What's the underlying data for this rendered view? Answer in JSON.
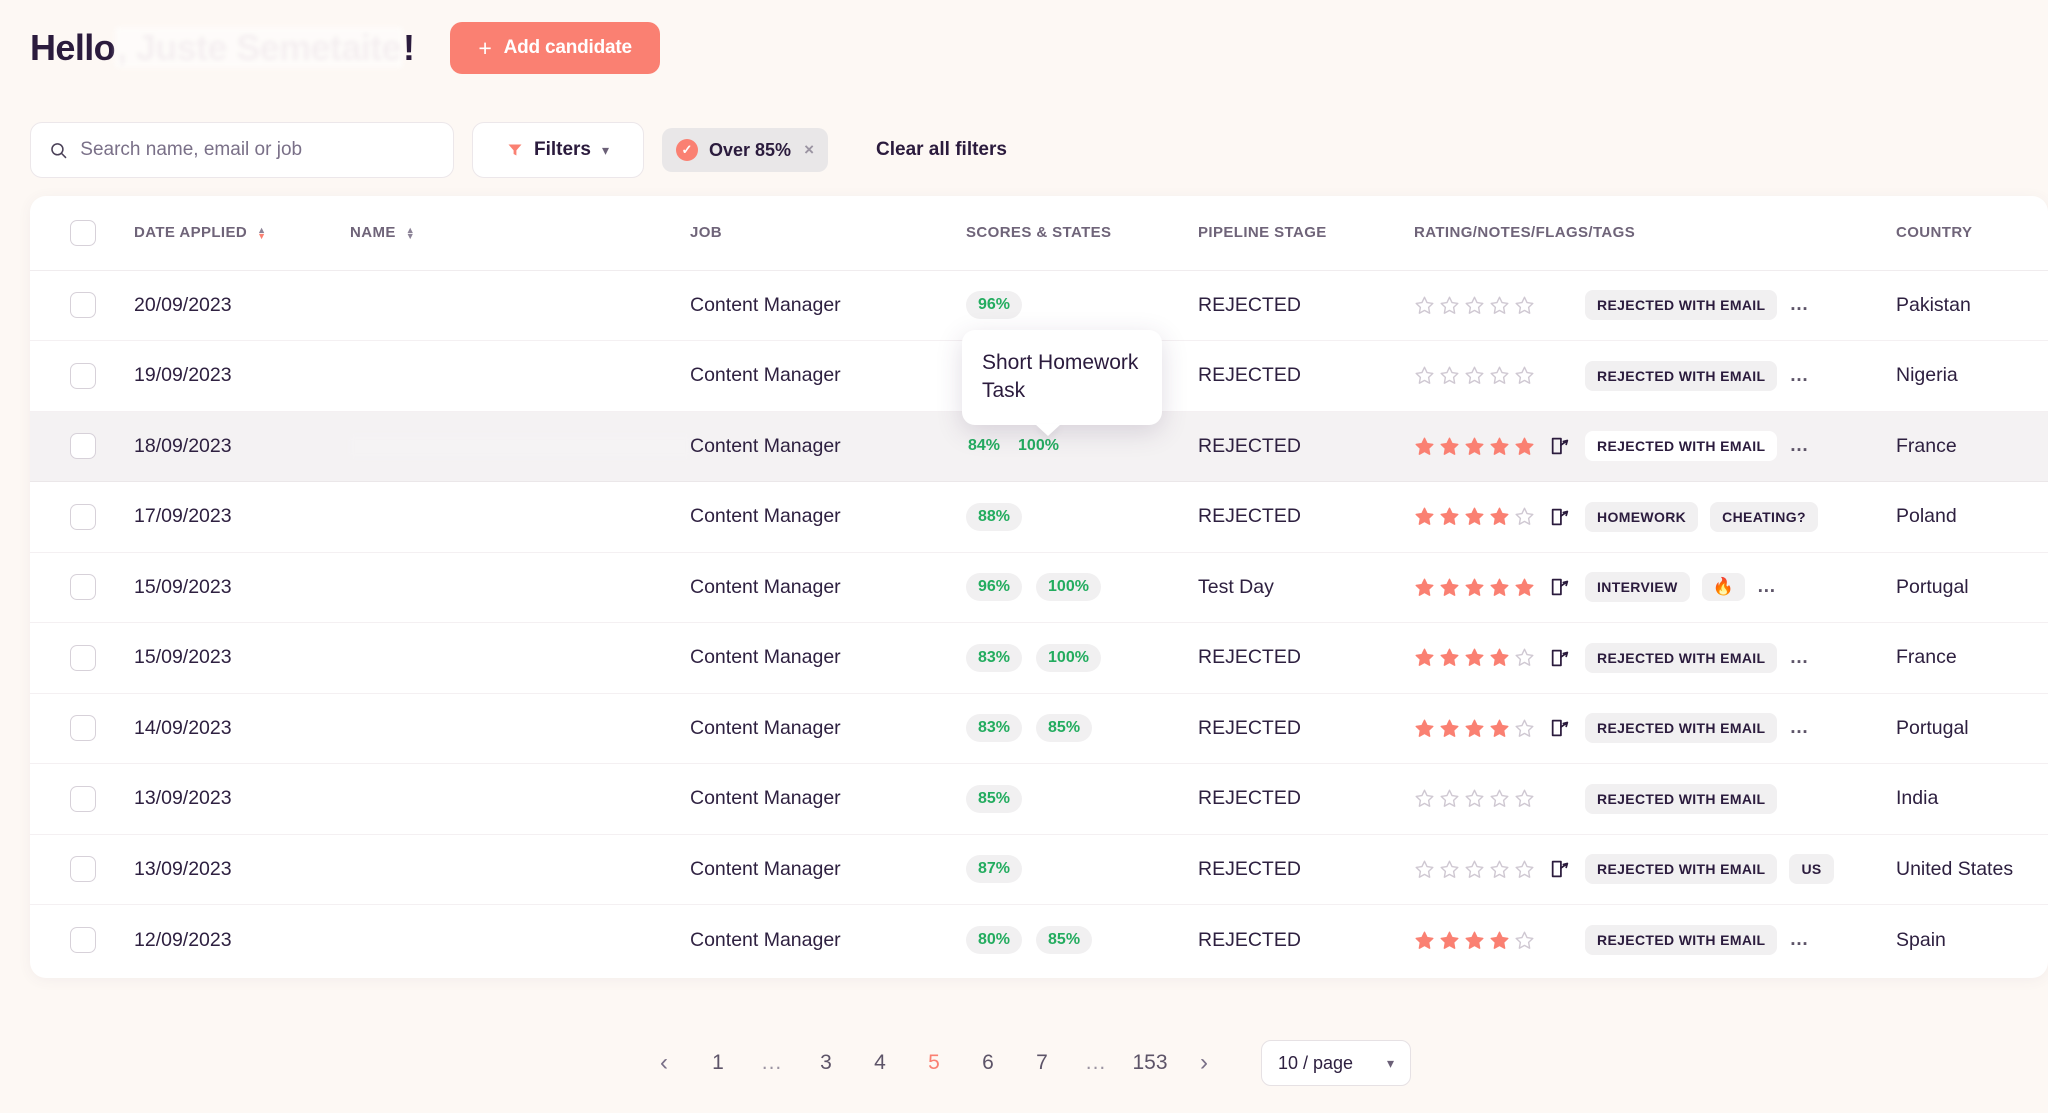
{
  "header": {
    "greeting_prefix": "Hello",
    "greeting_name": ", Juste Semetaite",
    "greeting_suffix": "!",
    "add_candidate_label": "Add candidate",
    "plus_icon": "plus-icon"
  },
  "filters": {
    "search_placeholder": "Search name, email or job",
    "search_value": "",
    "filters_label": "Filters",
    "chip_label": "Over 85%",
    "chip_remove": "×",
    "clear_all_label": "Clear all filters"
  },
  "table": {
    "columns": [
      {
        "key": "checkbox",
        "label": "",
        "sortable": false
      },
      {
        "key": "date",
        "label": "DATE APPLIED",
        "sortable": true
      },
      {
        "key": "name",
        "label": "NAME",
        "sortable": true
      },
      {
        "key": "job",
        "label": "JOB",
        "sortable": false
      },
      {
        "key": "scores",
        "label": "SCORES & STATES",
        "sortable": false
      },
      {
        "key": "stage",
        "label": "PIPELINE STAGE",
        "sortable": false
      },
      {
        "key": "rating",
        "label": "RATING/NOTES/FLAGS/TAGS",
        "sortable": false
      },
      {
        "key": "country",
        "label": "COUNTRY",
        "sortable": false
      }
    ],
    "rows": [
      {
        "date": "20/09/2023",
        "name": "",
        "job": "Content Manager",
        "scores": [
          "96%"
        ],
        "stage": "REJECTED",
        "rating": 0,
        "note": false,
        "tags": [
          "REJECTED WITH EMAIL"
        ],
        "more": true,
        "country": "Pakistan",
        "highlight": false
      },
      {
        "date": "19/09/2023",
        "name": "",
        "job": "Content Manager",
        "scores": [],
        "stage": "REJECTED",
        "rating": 0,
        "note": false,
        "tags": [
          "REJECTED WITH EMAIL"
        ],
        "more": true,
        "country": "Nigeria",
        "highlight": false
      },
      {
        "date": "18/09/2023",
        "name": "",
        "job": "Content Manager",
        "scores": [
          "84%",
          "100%"
        ],
        "stage": "REJECTED",
        "rating": 5,
        "note": true,
        "tags": [
          "REJECTED WITH EMAIL"
        ],
        "more": true,
        "country": "France",
        "highlight": true
      },
      {
        "date": "17/09/2023",
        "name": "",
        "job": "Content Manager",
        "scores": [
          "88%"
        ],
        "stage": "REJECTED",
        "rating": 4,
        "note": true,
        "tags": [
          "HOMEWORK",
          "CHEATING?"
        ],
        "more": false,
        "country": "Poland",
        "highlight": false
      },
      {
        "date": "15/09/2023",
        "name": "",
        "job": "Content Manager",
        "scores": [
          "96%",
          "100%"
        ],
        "stage": "Test Day",
        "rating": 5,
        "note": true,
        "tags": [
          "INTERVIEW",
          "🔥"
        ],
        "more": true,
        "country": "Portugal",
        "highlight": false
      },
      {
        "date": "15/09/2023",
        "name": "",
        "job": "Content Manager",
        "scores": [
          "83%",
          "100%"
        ],
        "stage": "REJECTED",
        "rating": 4,
        "note": true,
        "tags": [
          "REJECTED WITH EMAIL"
        ],
        "more": true,
        "country": "France",
        "highlight": false
      },
      {
        "date": "14/09/2023",
        "name": "",
        "job": "Content Manager",
        "scores": [
          "83%",
          "85%"
        ],
        "stage": "REJECTED",
        "rating": 4,
        "note": true,
        "tags": [
          "REJECTED WITH EMAIL"
        ],
        "more": true,
        "country": "Portugal",
        "highlight": false
      },
      {
        "date": "13/09/2023",
        "name": "",
        "job": "Content Manager",
        "scores": [
          "85%"
        ],
        "stage": "REJECTED",
        "rating": 0,
        "note": false,
        "tags": [
          "REJECTED WITH EMAIL"
        ],
        "more": false,
        "country": "India",
        "highlight": false
      },
      {
        "date": "13/09/2023",
        "name": "",
        "job": "Content Manager",
        "scores": [
          "87%"
        ],
        "stage": "REJECTED",
        "rating": 0,
        "note": true,
        "tags": [
          "REJECTED WITH EMAIL",
          "US"
        ],
        "more": false,
        "country": "United States",
        "highlight": false
      },
      {
        "date": "12/09/2023",
        "name": "",
        "job": "Content Manager",
        "scores": [
          "80%",
          "85%"
        ],
        "stage": "REJECTED",
        "rating": 4,
        "note": false,
        "tags": [
          "REJECTED WITH EMAIL"
        ],
        "more": true,
        "country": "Spain",
        "highlight": false
      }
    ]
  },
  "tooltip": {
    "text": "Short Homework Task"
  },
  "pagination": {
    "prev": "‹",
    "next": "›",
    "items": [
      "1",
      "...",
      "3",
      "4",
      "5",
      "6",
      "7",
      "...",
      "153"
    ],
    "current": "5",
    "per_page_label": "10 / page"
  },
  "colors": {
    "accent": "#fa8072",
    "score_green": "#23ac5f",
    "page_bg": "#fdf8f4",
    "text": "#2e2040"
  }
}
